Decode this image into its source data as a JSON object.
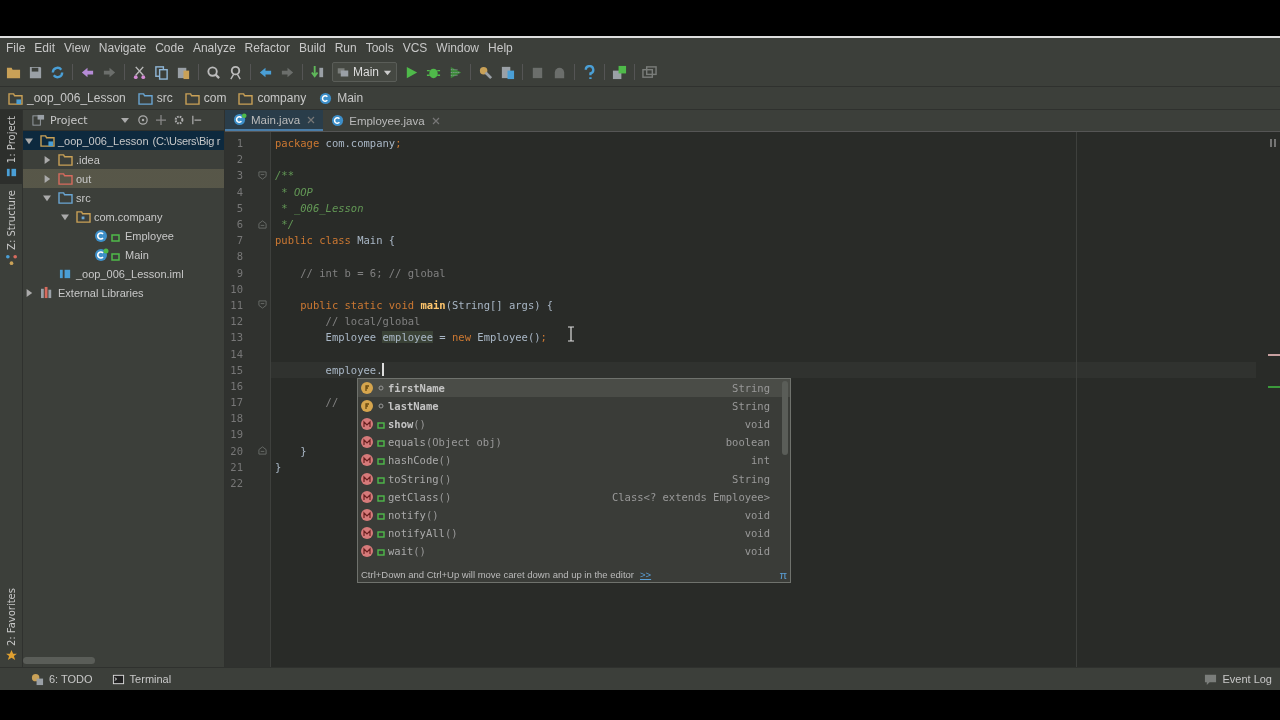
{
  "menu": [
    "File",
    "Edit",
    "View",
    "Navigate",
    "Code",
    "Analyze",
    "Refactor",
    "Build",
    "Run",
    "Tools",
    "VCS",
    "Window",
    "Help"
  ],
  "run_config": "Main",
  "breadcrumbs": [
    {
      "label": "_oop_006_Lesson",
      "kind": "module"
    },
    {
      "label": "src",
      "kind": "source"
    },
    {
      "label": "com",
      "kind": "folder"
    },
    {
      "label": "company",
      "kind": "folder"
    },
    {
      "label": "Main",
      "kind": "class"
    }
  ],
  "side_tabs": [
    {
      "label": "1: Project",
      "selected": true,
      "kind": "project"
    },
    {
      "label": "Z: Structure",
      "selected": false,
      "kind": "structure"
    }
  ],
  "favorites_tab": "2: Favorites",
  "project_panel": {
    "title": "Project",
    "tree": [
      {
        "label": "_oop_006_Lesson",
        "detail": "(C:\\Users\\Big r",
        "kind": "module",
        "expanded": true,
        "selected": true,
        "highlighted": false,
        "children": [
          {
            "label": ".idea",
            "kind": "folder",
            "expanded": false,
            "selected": false,
            "highlighted": false
          },
          {
            "label": "out",
            "kind": "excluded",
            "expanded": false,
            "selected": false,
            "highlighted": true
          },
          {
            "label": "src",
            "kind": "source",
            "expanded": true,
            "selected": false,
            "highlighted": false,
            "children": [
              {
                "label": "com.company",
                "kind": "package",
                "expanded": true,
                "selected": false,
                "highlighted": false,
                "children": [
                  {
                    "label": "Employee",
                    "kind": "class",
                    "selected": false,
                    "highlighted": false
                  },
                  {
                    "label": "Main",
                    "kind": "main-class",
                    "selected": false,
                    "highlighted": false
                  }
                ]
              }
            ]
          },
          {
            "label": "_oop_006_Lesson.iml",
            "kind": "iml",
            "selected": false,
            "highlighted": false
          }
        ]
      },
      {
        "label": "External Libraries",
        "kind": "libraries",
        "expanded": false,
        "selected": false,
        "highlighted": false
      }
    ]
  },
  "tabs": [
    {
      "label": "Main.java",
      "selected": true,
      "kind": "main-class"
    },
    {
      "label": "Employee.java",
      "selected": false,
      "kind": "class"
    }
  ],
  "code": [
    {
      "number": "1",
      "kind": "plain",
      "tokens": [
        {
          "text": "package",
          "kind": "keyword"
        },
        {
          "text": " com.company",
          "kind": "plain"
        },
        {
          "text": ";",
          "kind": "keyword"
        }
      ]
    },
    {
      "number": "2",
      "kind": "plain"
    },
    {
      "number": "3",
      "kind": "fold-start",
      "tokens": [
        {
          "text": "/**",
          "kind": "doc"
        }
      ]
    },
    {
      "number": "4",
      "kind": "plain",
      "tokens": [
        {
          "text": " * OOP",
          "kind": "doc"
        }
      ]
    },
    {
      "number": "5",
      "kind": "plain",
      "tokens": [
        {
          "text": " * _006_Lesson",
          "kind": "doc"
        }
      ]
    },
    {
      "number": "6",
      "kind": "fold-end",
      "tokens": [
        {
          "text": " */",
          "kind": "doc"
        }
      ]
    },
    {
      "number": "7",
      "kind": "plain",
      "tokens": [
        {
          "text": "public class ",
          "kind": "keyword"
        },
        {
          "text": "Main {",
          "kind": "plain"
        }
      ]
    },
    {
      "number": "8",
      "kind": "plain"
    },
    {
      "number": "9",
      "kind": "plain",
      "tokens": [
        {
          "text": "    // int b = 6; // global",
          "kind": "comment"
        }
      ]
    },
    {
      "number": "10",
      "kind": "plain"
    },
    {
      "number": "11",
      "kind": "fold-start",
      "tokens": [
        {
          "text": "    public static void ",
          "kind": "keyword"
        },
        {
          "text": "main",
          "kind": "method"
        },
        {
          "text": "(String[] args) {",
          "kind": "plain"
        }
      ]
    },
    {
      "number": "12",
      "kind": "plain",
      "tokens": [
        {
          "text": "        // local/global",
          "kind": "comment"
        }
      ]
    },
    {
      "number": "13",
      "kind": "plain",
      "tokens": [
        {
          "text": "        Employee ",
          "kind": "plain"
        },
        {
          "text": "employee",
          "kind": "usage"
        },
        {
          "text": " = ",
          "kind": "plain"
        },
        {
          "text": "new ",
          "kind": "keyword"
        },
        {
          "text": "Employee()",
          "kind": "plain"
        },
        {
          "text": ";",
          "kind": "keyword"
        }
      ]
    },
    {
      "number": "14",
      "kind": "plain"
    },
    {
      "number": "15",
      "kind": "plain",
      "current": true,
      "tokens": [
        {
          "text": "        employee.",
          "kind": "plain"
        }
      ]
    },
    {
      "number": "16",
      "kind": "plain"
    },
    {
      "number": "17",
      "kind": "plain",
      "tokens": [
        {
          "text": "        //",
          "kind": "comment"
        }
      ]
    },
    {
      "number": "18",
      "kind": "plain"
    },
    {
      "number": "19",
      "kind": "plain"
    },
    {
      "number": "20",
      "kind": "fold-end",
      "tokens": [
        {
          "text": "    }",
          "kind": "plain"
        }
      ]
    },
    {
      "number": "21",
      "kind": "plain",
      "tokens": [
        {
          "text": "}",
          "kind": "plain"
        }
      ]
    },
    {
      "number": "22",
      "kind": "plain"
    }
  ],
  "completion": {
    "items": [
      {
        "kind": "field",
        "name": "firstName",
        "type": "String",
        "bold": true,
        "selected": true
      },
      {
        "kind": "field",
        "name": "lastName",
        "type": "String",
        "bold": true,
        "selected": false
      },
      {
        "kind": "method",
        "name": "show",
        "params": "()",
        "type": "void",
        "bold": true,
        "selected": false
      },
      {
        "kind": "method",
        "name": "equals",
        "params": "(Object obj)",
        "type": "boolean",
        "bold": false,
        "selected": false
      },
      {
        "kind": "method",
        "name": "hashCode",
        "params": "()",
        "type": "int",
        "bold": false,
        "selected": false
      },
      {
        "kind": "method",
        "name": "toString",
        "params": "()",
        "type": "String",
        "bold": false,
        "selected": false
      },
      {
        "kind": "method",
        "name": "getClass",
        "params": "()",
        "type": "Class<? extends Employee>",
        "bold": false,
        "selected": false
      },
      {
        "kind": "method",
        "name": "notify",
        "params": "()",
        "type": "void",
        "bold": false,
        "selected": false
      },
      {
        "kind": "method",
        "name": "notifyAll",
        "params": "()",
        "type": "void",
        "bold": false,
        "selected": false
      },
      {
        "kind": "method",
        "name": "wait",
        "params": "()",
        "type": "void",
        "bold": false,
        "selected": false
      }
    ],
    "hint": "Ctrl+Down and Ctrl+Up will move caret down and up in the editor",
    "hint_link": ">>",
    "corner": "π"
  },
  "status_bar": {
    "left": [
      {
        "label": "6: TODO",
        "kind": "todo"
      },
      {
        "label": "Terminal",
        "kind": "terminal"
      }
    ],
    "right": "Event Log"
  }
}
